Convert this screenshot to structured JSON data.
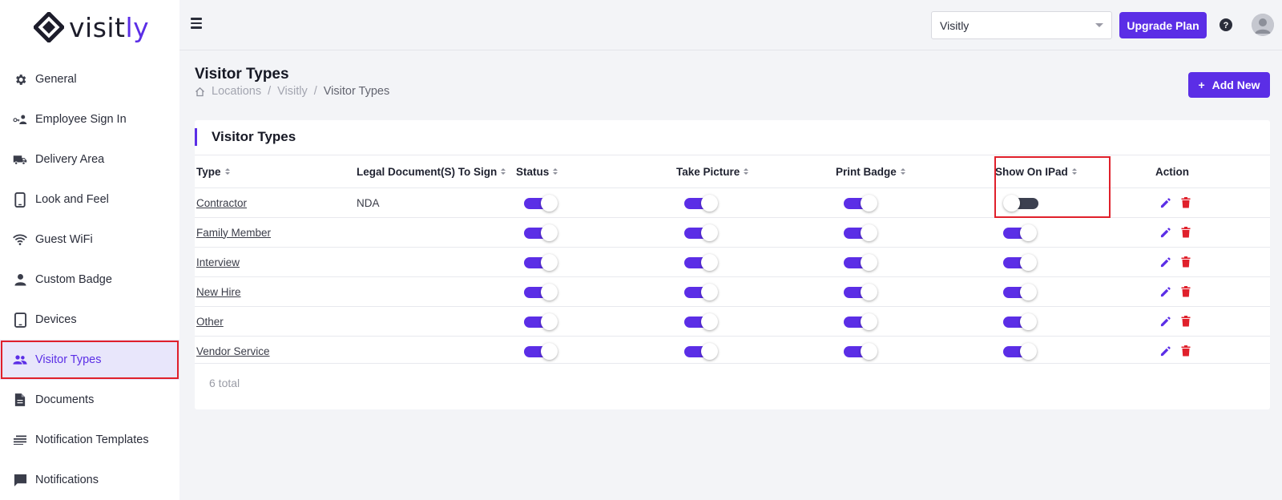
{
  "brand": {
    "logo_text_a": "visit",
    "logo_text_b": "ly",
    "accent": "#5b2ee6"
  },
  "sidebar": {
    "items": [
      {
        "label": "General",
        "icon": "gear-icon"
      },
      {
        "label": "Employee Sign In",
        "icon": "employee-key-icon"
      },
      {
        "label": "Delivery Area",
        "icon": "truck-icon"
      },
      {
        "label": "Look and Feel",
        "icon": "phone-icon"
      },
      {
        "label": "Guest WiFi",
        "icon": "wifi-icon"
      },
      {
        "label": "Custom Badge",
        "icon": "person-icon"
      },
      {
        "label": "Devices",
        "icon": "tablet-icon"
      },
      {
        "label": "Visitor Types",
        "icon": "people-icon",
        "active": true
      },
      {
        "label": "Documents",
        "icon": "document-icon"
      },
      {
        "label": "Notification Templates",
        "icon": "lines-icon"
      },
      {
        "label": "Notifications",
        "icon": "chat-icon"
      }
    ]
  },
  "topbar": {
    "location_value": "Visitly",
    "upgrade_label": "Upgrade Plan"
  },
  "page": {
    "title": "Visitor Types",
    "breadcrumb": [
      "Locations",
      "Visitly",
      "Visitor Types"
    ],
    "add_label": "Add New",
    "add_icon": "+"
  },
  "card": {
    "title": "Visitor Types",
    "columns": [
      "Type",
      "Legal Document(S) To Sign",
      "Status",
      "Take Picture",
      "Print Badge",
      "Show On IPad",
      "Action"
    ],
    "rows": [
      {
        "type": "Contractor",
        "legal": "NDA",
        "status": true,
        "take_picture": true,
        "print_badge": true,
        "show_on_ipad": false
      },
      {
        "type": "Family Member",
        "legal": "",
        "status": true,
        "take_picture": true,
        "print_badge": true,
        "show_on_ipad": true
      },
      {
        "type": "Interview",
        "legal": "",
        "status": true,
        "take_picture": true,
        "print_badge": true,
        "show_on_ipad": true
      },
      {
        "type": "New Hire",
        "legal": "",
        "status": true,
        "take_picture": true,
        "print_badge": true,
        "show_on_ipad": true
      },
      {
        "type": "Other",
        "legal": "",
        "status": true,
        "take_picture": true,
        "print_badge": true,
        "show_on_ipad": true
      },
      {
        "type": "Vendor Service",
        "legal": "",
        "status": true,
        "take_picture": true,
        "print_badge": true,
        "show_on_ipad": true
      }
    ],
    "total_text": "6 total"
  },
  "colors": {
    "edit": "#5b2ee6",
    "delete": "#e0202b",
    "toggle_on": "#5b2ee6",
    "toggle_off": "#3c4050"
  }
}
